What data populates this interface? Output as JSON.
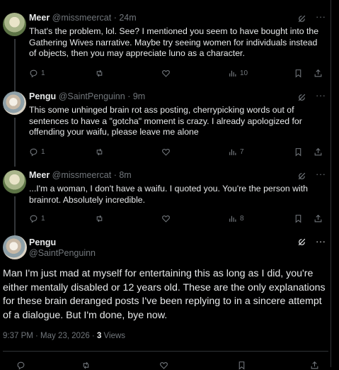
{
  "colors": {
    "background": "#000000",
    "text": "#e7e9ea",
    "muted": "#71767b",
    "border": "#2f3336"
  },
  "replies": [
    {
      "name": "Meer",
      "handle": "@missmeercat",
      "time": "24m",
      "text": "That's the problem, lol. See? I mentioned you seem to have bought into the Gathering Wives narrative. Maybe try seeing women for individuals instead of objects, then you may appreciate luno as a character.",
      "replies": "1",
      "views": "10"
    },
    {
      "name": "Pengu",
      "handle": "@SaintPenguinn",
      "time": "9m",
      "text": "This some unhinged brain rot ass posting, cherrypicking words out of sentences to have a \"gotcha\" moment is crazy. I already apologized for offending your waifu, please leave me alone",
      "replies": "1",
      "views": "7"
    },
    {
      "name": "Meer",
      "handle": "@missmeercat",
      "time": "8m",
      "text": "...I'm a woman, I don't have a waifu. I quoted you. You're the person with brainrot. Absolutely incredible.",
      "replies": "1",
      "views": "8"
    }
  ],
  "main_post": {
    "name": "Pengu",
    "handle": "@SaintPenguinn",
    "text": "Man I'm just mad at myself for entertaining this as long as I did, you're either mentally disabled or 12 years old. These are the only explanations for these brain deranged posts I've been replying to in a sincere attempt of a dialogue. But I'm done, bye now.",
    "timestamp": "9:37 PM · May 23, 2026 · ",
    "views_count": "3",
    "views_label": " Views"
  },
  "separator": "·",
  "icons": [
    "grok-icon",
    "more-icon",
    "reply-icon",
    "repost-icon",
    "like-icon",
    "views-icon",
    "bookmark-icon",
    "share-icon"
  ]
}
